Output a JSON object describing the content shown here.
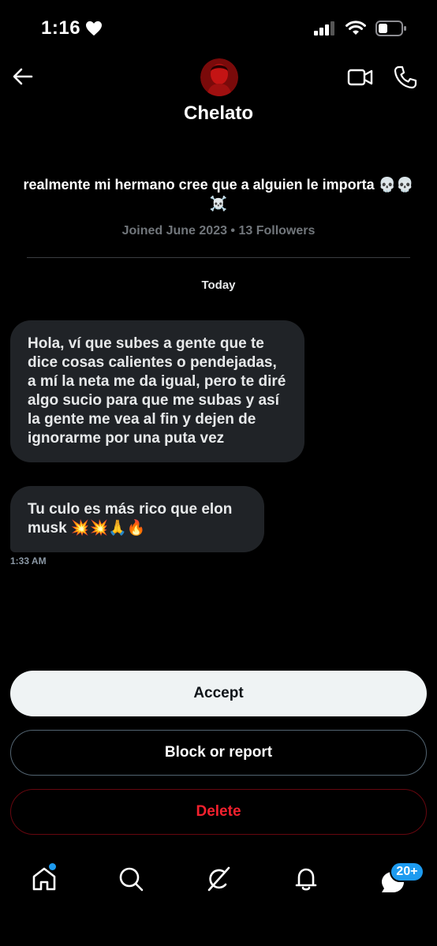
{
  "status_bar": {
    "time": "1:16"
  },
  "header": {
    "contact_name": "Chelato",
    "bio": "realmente mi hermano cree que a alguien le importa 💀💀☠️",
    "joined": "Joined June 2023 • 13 Followers"
  },
  "conversation": {
    "date_label": "Today",
    "messages": [
      {
        "text": "Hola, ví que subes a gente que te dice cosas calientes o pendejadas, a mí la neta me da igual, pero te diré algo sucio para que me subas y así la gente me vea al fin y dejen de ignorarme por una puta vez"
      },
      {
        "text": "Tu culo es más rico que elon musk 💥💥🙏🔥"
      }
    ],
    "last_time": "1:33 AM"
  },
  "actions": {
    "accept": "Accept",
    "block": "Block or report",
    "delete": "Delete"
  },
  "bottom_nav": {
    "messages_badge": "20+"
  },
  "colors": {
    "accent": "#1d9bf0",
    "danger": "#f4212e",
    "bubble": "#202327"
  }
}
